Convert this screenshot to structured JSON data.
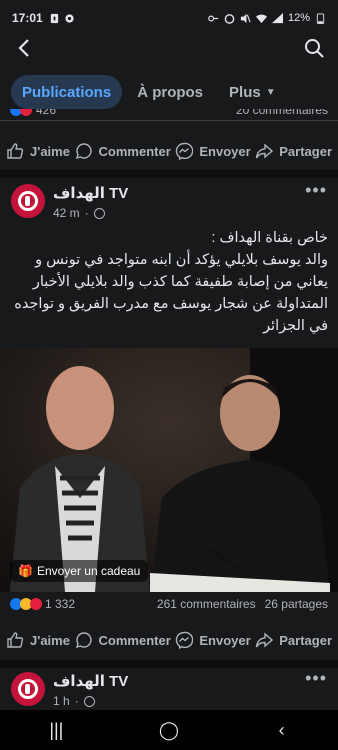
{
  "status_bar": {
    "time": "17:01",
    "battery": "12%"
  },
  "nav": {
    "back_icon": "arrow-left-icon",
    "search_icon": "search-icon"
  },
  "tabs": [
    {
      "label": "Publications",
      "active": true
    },
    {
      "label": "À propos",
      "active": false
    },
    {
      "label": "Plus",
      "active": false
    }
  ],
  "previous_post": {
    "reactions_count": "426",
    "comments_text": "20 commentaires"
  },
  "actions": {
    "like": "J'aime",
    "comment": "Commenter",
    "send": "Envoyer",
    "share": "Partager"
  },
  "post": {
    "page_name": "الهداف TV",
    "time": "42 m",
    "text": "خاص بقناة الهداف :\nوالد يوسف بلايلي يؤكد أن ابنه متواجد في تونس و يعاني من إصابة طفيفة كما كذب والد بلايلي الأخبار المتداولة عن شجار يوسف مع مدرب الفريق و تواجده في الجزائر",
    "gift_label": "Envoyer un cadeau",
    "reactions_count": "1 332",
    "comments": "261 commentaires",
    "shares": "26 partages"
  },
  "next_post": {
    "page_name": "الهداف TV",
    "time": "1 h"
  },
  "colors": {
    "accent": "#5aa7ff",
    "tab_active_bg": "#263951",
    "background": "#18191a",
    "brand_avatar": "#c4143c"
  }
}
